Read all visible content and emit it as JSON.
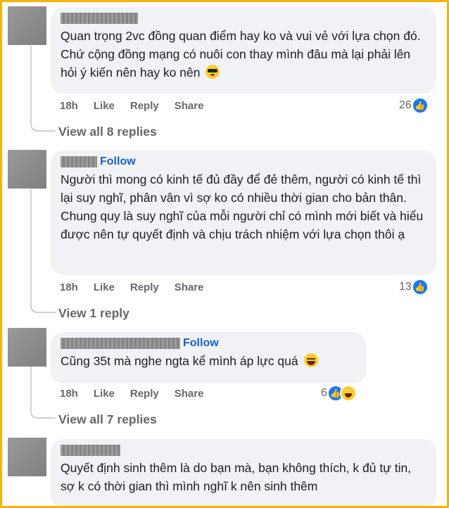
{
  "comments": [
    {
      "text": "Quan trọng 2vc đồng quan điểm hay ko và vui vẻ với lựa chọn đó. Chứ cộng đồng mạng có nuôi con thay mình đâu mà lại phải lên hỏi ý kiến nên hay ko nên",
      "emoji": "sunglasses-emoji",
      "time": "18h",
      "like": "Like",
      "reply": "Reply",
      "share": "Share",
      "reaction_count": "26",
      "view_replies": "View all 8 replies"
    },
    {
      "follow": "Follow",
      "text": "Người thì mong có kinh tế đủ đầy để đẻ thêm, người có kinh tế thì lại suy nghĩ, phân vân vì sợ ko có nhiều thời gian cho bản thân. Chung quy là suy nghĩ của mỗi người chỉ có mình mới biết và hiểu được nên tự quyết định và chịu trách nhiệm với lựa chọn thôi ạ",
      "time": "18h",
      "like": "Like",
      "reply": "Reply",
      "share": "Share",
      "reaction_count": "13",
      "view_replies": "View 1 reply"
    },
    {
      "follow": "Follow",
      "text": "Cũng 35t mà nghe ngta kể mình áp lực quá",
      "emoji": "laughing-emoji",
      "time": "18h",
      "like": "Like",
      "reply": "Reply",
      "share": "Share",
      "reaction_count": "6",
      "view_replies": "View all 7 replies"
    },
    {
      "text": "Quyết định sinh thêm là do bạn mà, bạn không thích, k đủ tự tin, sợ k có thời gian thì mình nghĩ k nên sinh thêm"
    }
  ],
  "colors": {
    "frame": "#f5b400",
    "bubble": "#f0f2f5",
    "follow": "#1b5fc7",
    "like_reaction": "#1877f2",
    "meta_text": "#65676b"
  }
}
